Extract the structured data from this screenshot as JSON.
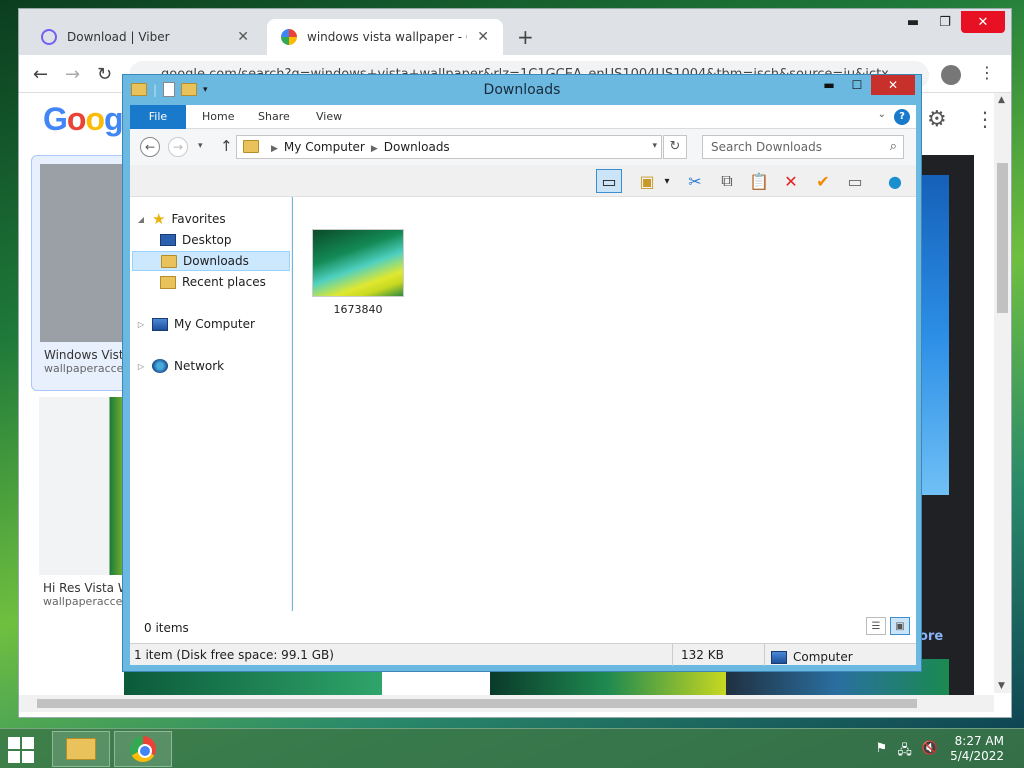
{
  "browser": {
    "tabs": [
      {
        "label": "Download | Viber",
        "icon": "viber-icon"
      },
      {
        "label": "windows vista wallpaper - Googl",
        "icon": "google-icon"
      }
    ],
    "url": "google.com/search?q=windows+vista+wallpaper&rlz=1C1GCEA_enUS1004US1004&tbm=isch&source=iu&ictx",
    "results": [
      {
        "title": "Windows Vista",
        "source": "wallpaperacces"
      },
      {
        "title": "Hi Res Vista W",
        "source": "wallpaperacces"
      }
    ],
    "more_text": "ore"
  },
  "explorer": {
    "title": "Downloads",
    "ribbon_tabs": [
      "File",
      "Home",
      "Share",
      "View"
    ],
    "address": {
      "root": "My Computer",
      "current": "Downloads"
    },
    "search_placeholder": "Search Downloads",
    "nav": {
      "favorites": "Favorites",
      "desktop": "Desktop",
      "downloads": "Downloads",
      "recent": "Recent places",
      "computer": "My Computer",
      "network": "Network"
    },
    "files": [
      {
        "name": "1673840"
      }
    ],
    "status_count": "0 items",
    "details": {
      "selection": "1 item (Disk free space: 99.1 GB)",
      "size": "132 KB",
      "location": "Computer"
    }
  },
  "taskbar": {
    "time": "8:27 AM",
    "date": "5/4/2022"
  },
  "colors": {
    "ribbon_file": "#1979ca",
    "close_red": "#c7302b",
    "selection": "#cce8ff"
  }
}
